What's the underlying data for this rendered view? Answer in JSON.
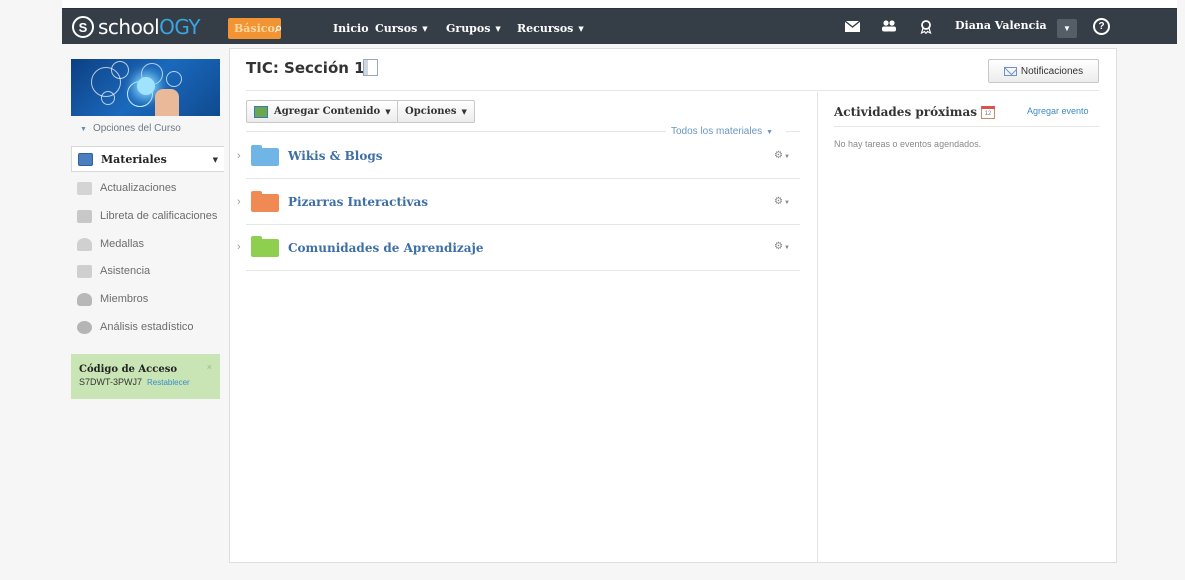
{
  "topbar": {
    "logo_s": "S",
    "logo_school": "school",
    "logo_ogy": "OGY",
    "basico": "Básico",
    "nav_items": [
      {
        "label": "Inicio"
      },
      {
        "label": "Cursos"
      },
      {
        "label": "Grupos"
      },
      {
        "label": "Recursos"
      }
    ],
    "user_name": "Diana Valencia"
  },
  "sidebar": {
    "course_options": "Opciones del Curso",
    "items": [
      {
        "label": "Materiales",
        "icon": "materials-icon",
        "color": "#4a7fbf"
      },
      {
        "label": "Actualizaciones",
        "icon": "updates-icon",
        "color": "#c8c8c8"
      },
      {
        "label": "Libreta de calificaciones",
        "icon": "gradebook-icon",
        "color": "#c8c8c8"
      },
      {
        "label": "Medallas",
        "icon": "badges-icon",
        "color": "#c8c8c8"
      },
      {
        "label": "Asistencia",
        "icon": "attendance-icon",
        "color": "#c8c8c8"
      },
      {
        "label": "Miembros",
        "icon": "members-icon",
        "color": "#b0b0b0"
      },
      {
        "label": "Análisis estadístico",
        "icon": "analytics-icon",
        "color": "#b0b0b0"
      }
    ],
    "access": {
      "title": "Código de Acceso",
      "code": "S7DWT-3PWJ7",
      "reset": "Restablecer",
      "close": "×"
    }
  },
  "main": {
    "title": "TIC: Sección 1",
    "notifications": "Notificaciones",
    "add_content": "Agregar Contenido",
    "options": "Opciones",
    "filter": "Todos los materiales",
    "folders": [
      {
        "title": "Wikis & Blogs",
        "color": "#6fb6e6"
      },
      {
        "title": "Pizarras Interactivas",
        "color": "#f08a55"
      },
      {
        "title": "Comunidades de Aprendizaje",
        "color": "#8fcf4f"
      }
    ]
  },
  "upcoming": {
    "title": "Actividades próximas",
    "add_event": "Agregar evento",
    "calendar_day": "12",
    "empty": "No hay tareas o eventos agendados."
  },
  "colors": {
    "topbar": "#353e47",
    "accent": "#f29433",
    "link": "#3d6fa5",
    "access_bg": "#c9e5b5"
  }
}
